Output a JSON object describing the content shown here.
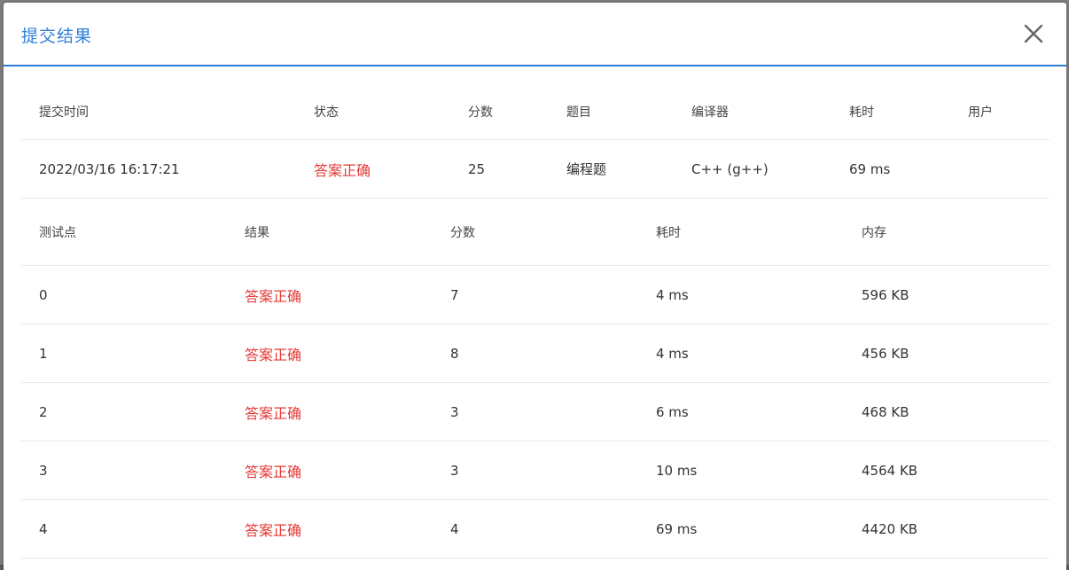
{
  "dialog": {
    "title": "提交结果"
  },
  "summary": {
    "headers": [
      "提交时间",
      "状态",
      "分数",
      "题目",
      "编译器",
      "耗时",
      "用户"
    ],
    "row": {
      "submit_time": "2022/03/16 16:17:21",
      "status": "答案正确",
      "score": "25",
      "problem": "编程题",
      "compiler": "C++ (g++)",
      "time": "69 ms",
      "user": ""
    }
  },
  "cases": {
    "headers": [
      "测试点",
      "结果",
      "分数",
      "耗时",
      "内存"
    ],
    "rows": [
      {
        "id": "0",
        "result": "答案正确",
        "score": "7",
        "time": "4 ms",
        "memory": "596 KB"
      },
      {
        "id": "1",
        "result": "答案正确",
        "score": "8",
        "time": "4 ms",
        "memory": "456 KB"
      },
      {
        "id": "2",
        "result": "答案正确",
        "score": "3",
        "time": "6 ms",
        "memory": "468 KB"
      },
      {
        "id": "3",
        "result": "答案正确",
        "score": "3",
        "time": "10 ms",
        "memory": "4564 KB"
      },
      {
        "id": "4",
        "result": "答案正确",
        "score": "4",
        "time": "69 ms",
        "memory": "4420 KB"
      }
    ]
  },
  "colors": {
    "accent": "#2f7fd6",
    "success_text": "#e53935"
  }
}
